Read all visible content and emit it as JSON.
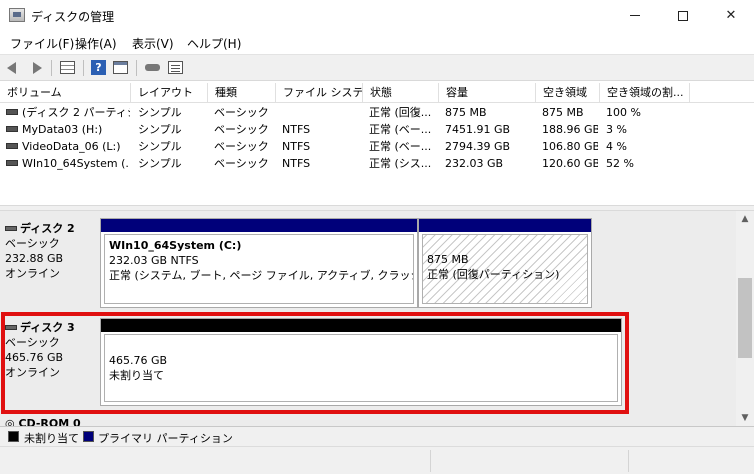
{
  "window": {
    "title": "ディスクの管理"
  },
  "menu": [
    "ファイル(F)",
    "操作(A)",
    "表示(V)",
    "ヘルプ(H)"
  ],
  "toolbar": {
    "help_glyph": "?"
  },
  "volume_list": {
    "columns": [
      "ボリューム",
      "レイアウト",
      "種類",
      "ファイル システム",
      "状態",
      "容量",
      "空き領域",
      "空き領域の割..."
    ],
    "rows": [
      [
        "(ディスク 2 パーティシ...",
        "シンプル",
        "ベーシック",
        "",
        "正常 (回復...",
        "875 MB",
        "875 MB",
        "100 %"
      ],
      [
        "MyData03 (H:)",
        "シンプル",
        "ベーシック",
        "NTFS",
        "正常 (ベー...",
        "7451.91 GB",
        "188.96 GB",
        "3 %"
      ],
      [
        "VideoData_06 (L:)",
        "シンプル",
        "ベーシック",
        "NTFS",
        "正常 (ベー...",
        "2794.39 GB",
        "106.80 GB",
        "4 %"
      ],
      [
        "WIn10_64System (...",
        "シンプル",
        "ベーシック",
        "NTFS",
        "正常 (シス...",
        "232.03 GB",
        "120.60 GB",
        "52 %"
      ]
    ]
  },
  "disks": {
    "disk2": {
      "name": "ディスク 2",
      "type": "ベーシック",
      "size": "232.88 GB",
      "status": "オンライン",
      "partitions": {
        "system": {
          "title": "WIn10_64System  (C:)",
          "size_fs": "232.03 GB NTFS",
          "status": "正常 (システム, ブート, ページ ファイル, アクティブ, クラッシュ ダンプ, ",
          "bar_color": "#00007a"
        },
        "recovery": {
          "size": "875 MB",
          "status": "正常 (回復パーティション)",
          "bar_color": "#00007a"
        }
      }
    },
    "disk3": {
      "name": "ディスク 3",
      "type": "ベーシック",
      "size": "465.76 GB",
      "status": "オンライン",
      "partitions": {
        "unallocated": {
          "size": "465.76 GB",
          "status": "未割り当て",
          "bar_color": "#000000"
        }
      }
    },
    "cdrom": {
      "name": "CD-ROM 0"
    }
  },
  "legend": [
    {
      "label": "未割り当て",
      "color": "#000000"
    },
    {
      "label": "プライマリ パーティション",
      "color": "#00007a"
    }
  ],
  "colors": {
    "highlight": "#e01010"
  }
}
